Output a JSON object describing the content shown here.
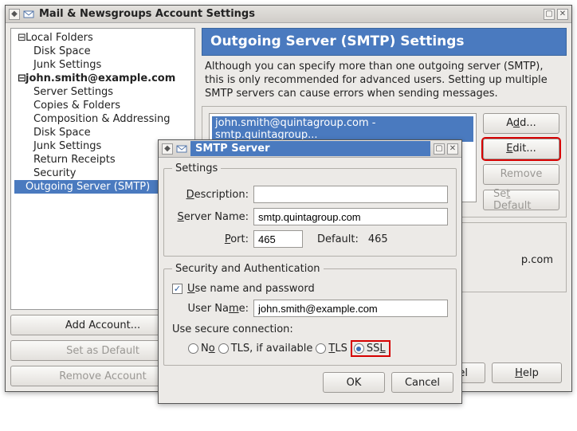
{
  "main_window": {
    "title": "Mail & Newsgroups Account Settings",
    "tree": {
      "local_folders": "Local Folders",
      "local_disk_space": "Disk Space",
      "local_junk": "Junk Settings",
      "account": "john.smith@example.com",
      "server_settings": "Server Settings",
      "copies_folders": "Copies & Folders",
      "composition": "Composition & Addressing",
      "disk_space": "Disk Space",
      "junk": "Junk Settings",
      "return_receipts": "Return Receipts",
      "security": "Security",
      "smtp_page": "Outgoing Server (SMTP)"
    },
    "tree_buttons": {
      "add_account": "Add Account...",
      "set_default": "Set as Default",
      "remove_account": "Remove Account"
    },
    "page": {
      "title": "Outgoing Server (SMTP) Settings",
      "description": "Although you can specify more than one outgoing server (SMTP), this is only recommended for advanced users. Setting up multiple SMTP servers can cause errors when sending messages.",
      "smtp_selected": "john.smith@quintagroup.com - smtp.quintagroup...",
      "btn_add": "Add...",
      "btn_edit": "Edit...",
      "btn_remove": "Remove",
      "btn_set_default": "Set Default",
      "detail_frag": "p.com"
    },
    "bottom": {
      "cancel": "Cancel",
      "help": "Help"
    }
  },
  "dialog": {
    "title": "SMTP Server",
    "settings": {
      "legend": "Settings",
      "desc_label": "Description:",
      "desc_value": "",
      "server_label": "Server Name:",
      "server_value": "smtp.quintagroup.com",
      "port_label": "Port:",
      "port_value": "465",
      "default_label": "Default:",
      "default_value": "465"
    },
    "security": {
      "legend": "Security and Authentication",
      "use_auth_label": "Use name and password",
      "use_auth_checked": true,
      "user_label": "User Name:",
      "user_value": "john.smith@example.com",
      "secure_label": "Use secure connection:",
      "opt_no": "No",
      "opt_tls_avail": "TLS, if available",
      "opt_tls": "TLS",
      "opt_ssl": "SSL",
      "selected": "ssl"
    },
    "buttons": {
      "ok": "OK",
      "cancel": "Cancel"
    }
  }
}
